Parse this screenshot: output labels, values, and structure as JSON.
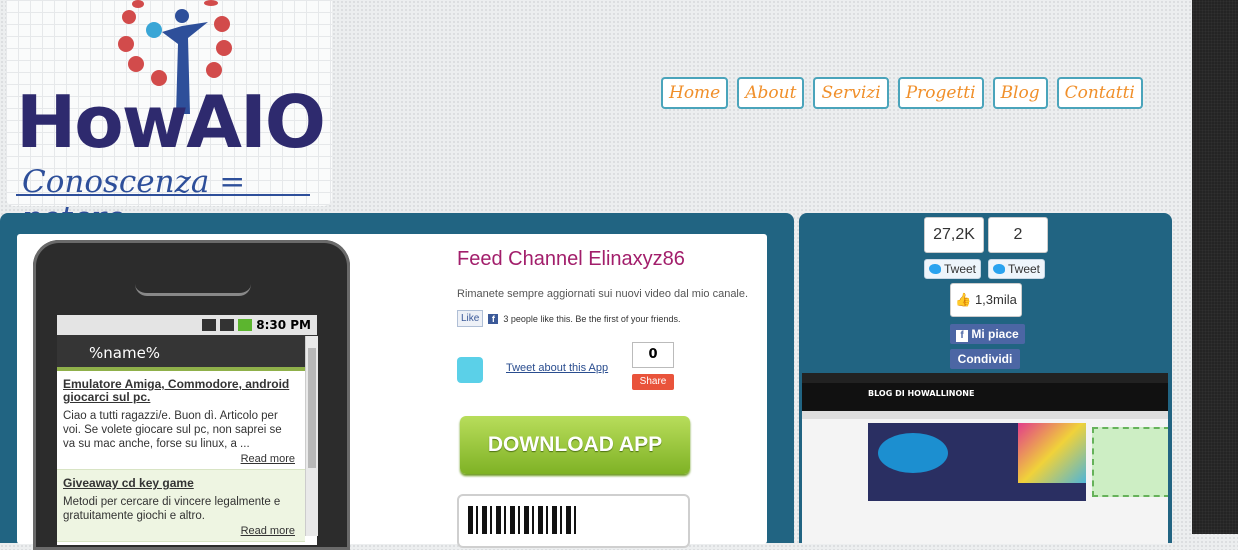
{
  "logo": {
    "word": "HowAIO",
    "tagline": "Conoscenza = potere"
  },
  "nav": [
    "Home",
    "About",
    "Servizi",
    "Progetti",
    "Blog",
    "Contatti"
  ],
  "phone": {
    "time": "8:30 PM",
    "app_title": "%name%",
    "items": [
      {
        "title": "Emulatore Amiga, Commodore, android giocarci sul pc.",
        "text": "Ciao a tutti ragazzi/e. Buon dì. Articolo per voi. Se volete giocare sul pc, non saprei se va su mac anche, forse su linux, a ...",
        "more": "Read more"
      },
      {
        "title": "Giveaway cd key game",
        "text": "Metodi per cercare di vincere legalmente e gratuitamente giochi e altro.",
        "more": "Read more"
      }
    ]
  },
  "feed": {
    "title": "Feed Channel Elinaxyz86",
    "subtitle": "Rimanete sempre aggiornati sui nuovi video dal mio canale.",
    "fb_like": "Like",
    "fb_text": "3 people like this. Be the first of your friends.",
    "tweet_link": "Tweet about this App",
    "share_count": "0",
    "share_label": "Share",
    "download_label": "DOWNLOAD APP"
  },
  "social": {
    "count1": "27,2K",
    "count2": "2",
    "tweet1": "Tweet",
    "tweet2": "Tweet",
    "likes": "1,3mila",
    "fb_mipiace": "Mi piace",
    "fb_condividi": "Condividi"
  },
  "blog_preview": {
    "title": "BLOG DI HOWALLINONE"
  },
  "colors": {
    "panel": "#216482",
    "nav_border": "#4aa4bb",
    "nav_text": "#f08f2a",
    "feed_title": "#a21e6b"
  }
}
